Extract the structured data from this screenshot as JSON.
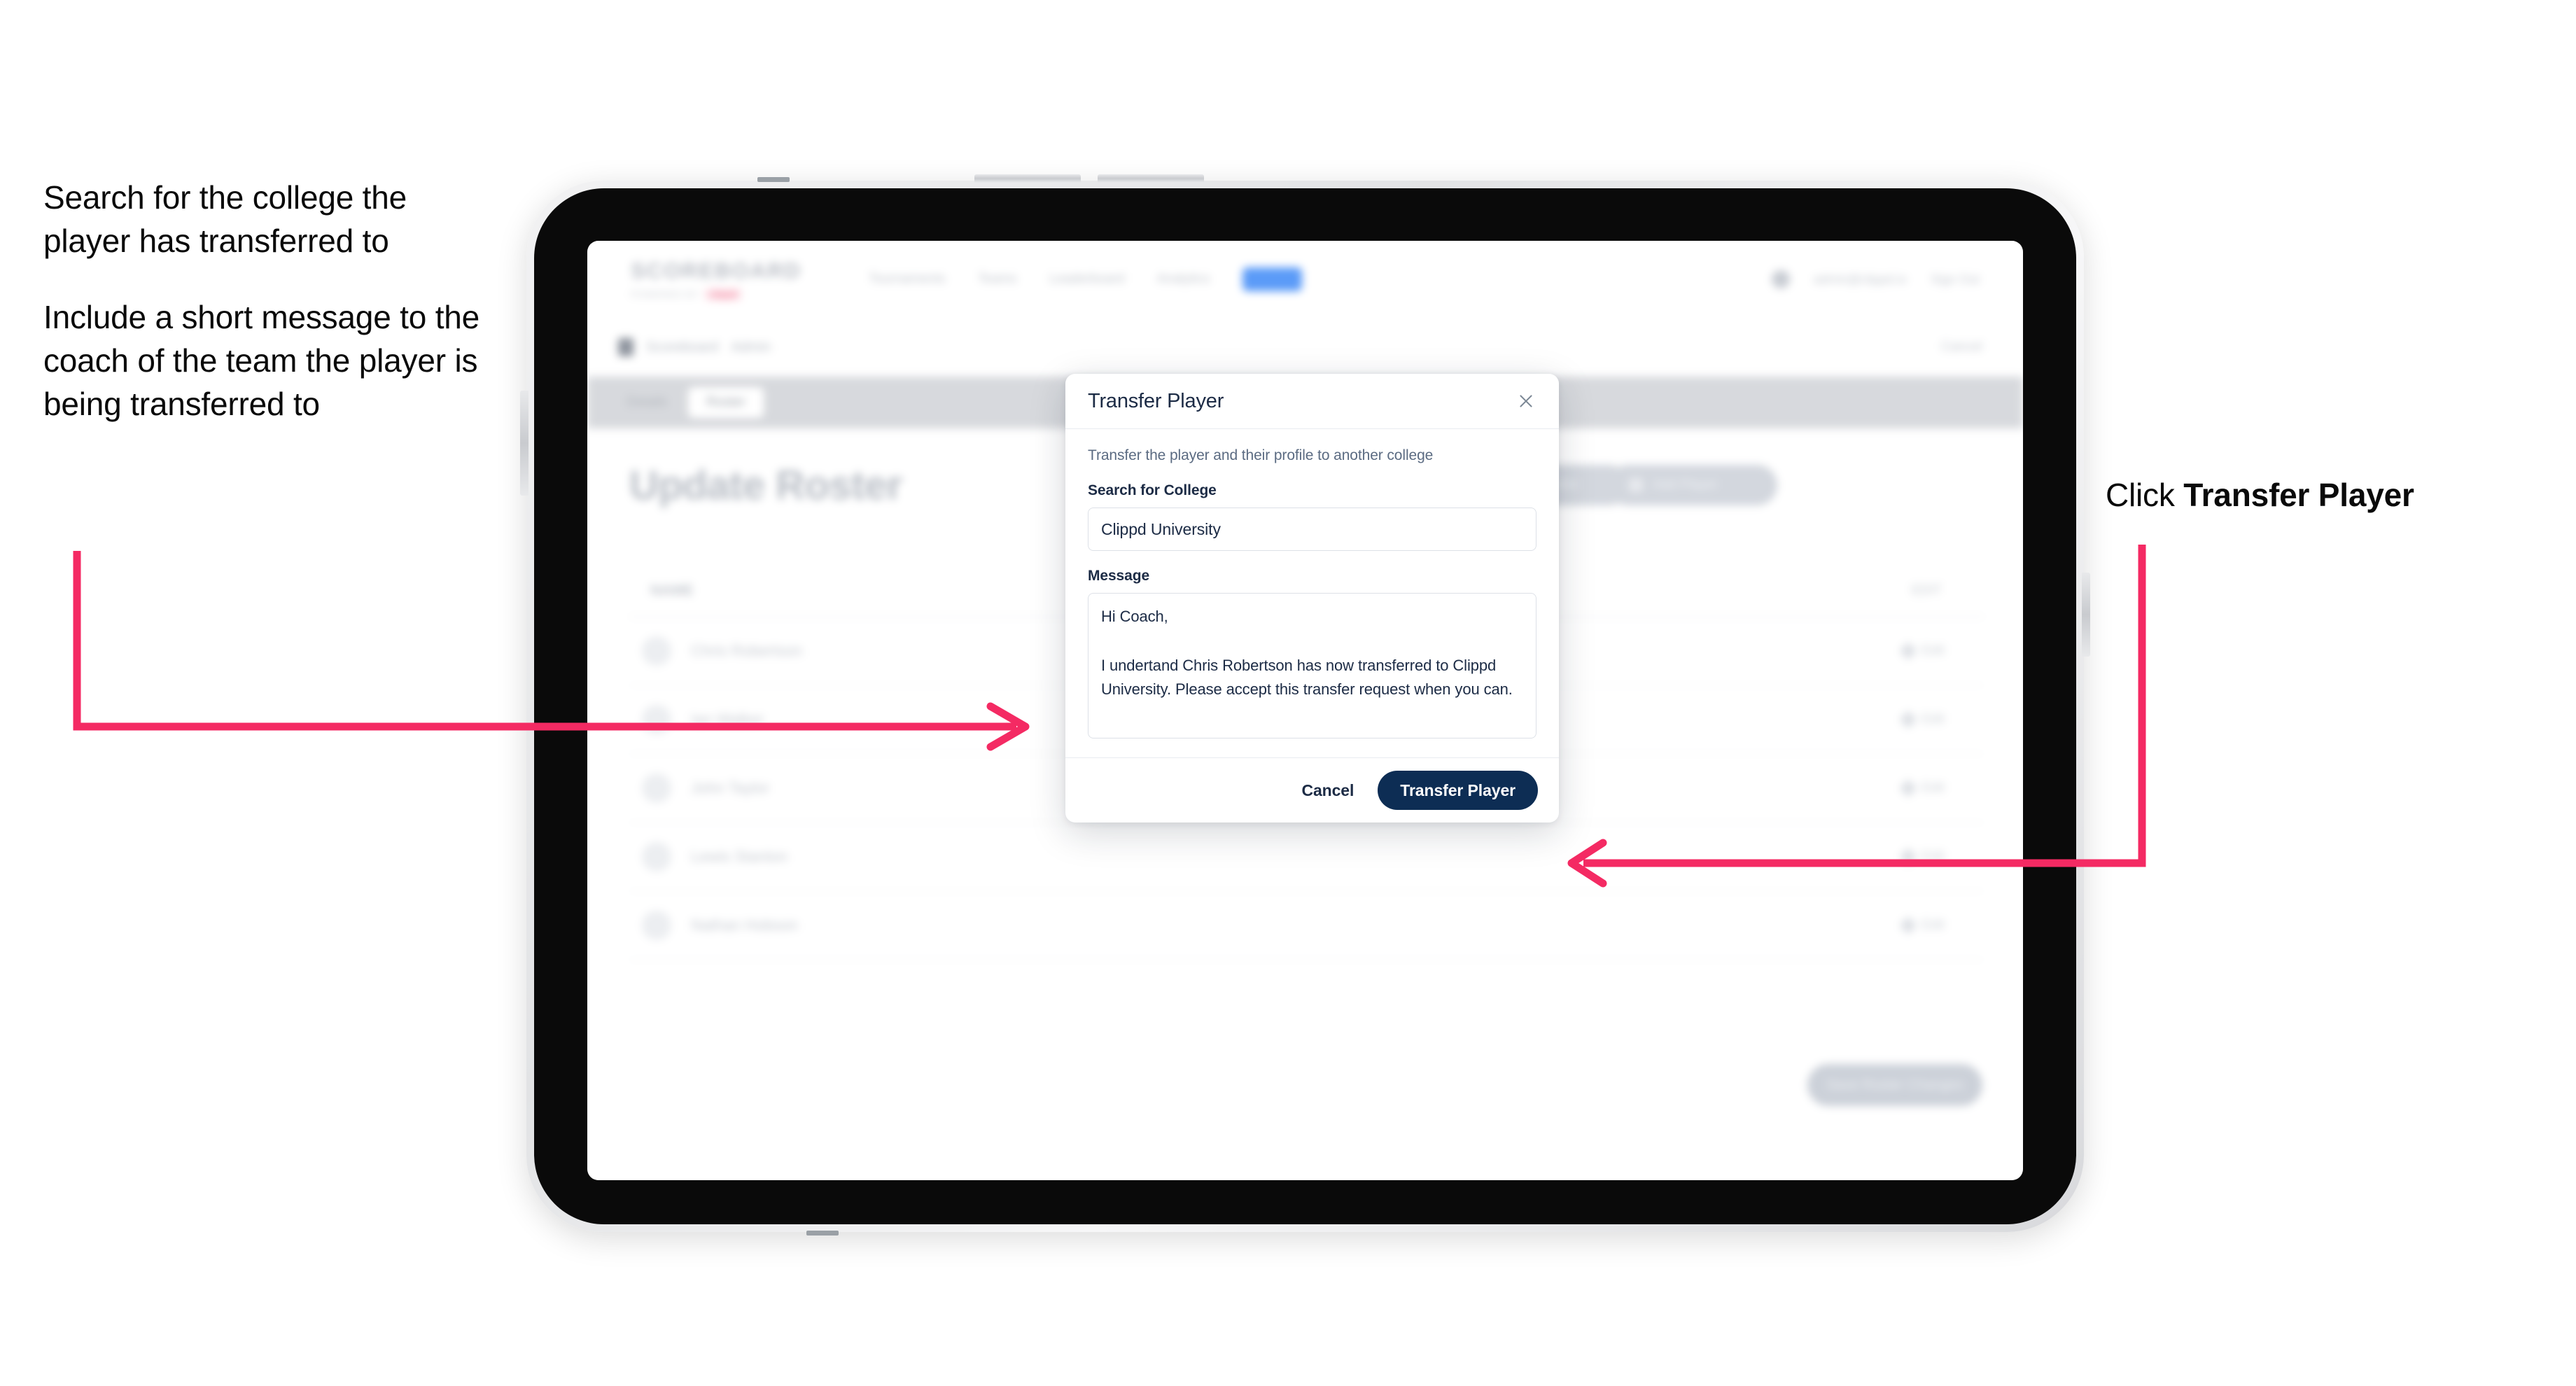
{
  "annotations": {
    "left": [
      "Search for the college the player has transferred to",
      "Include a short message to the coach of the team the player is being transferred to"
    ],
    "right_prefix": "Click ",
    "right_bold": "Transfer Player",
    "arrow_color": "#f42a63"
  },
  "app": {
    "logo": {
      "main": "SCOREBOARD",
      "sub": "POWERED BY",
      "badge": "clippd"
    },
    "nav_links": [
      {
        "label": "Tournaments",
        "active": true
      },
      {
        "label": "Teams",
        "active": false
      },
      {
        "label": "Leaderboard",
        "active": false
      },
      {
        "label": "Analytics",
        "active": false
      },
      {
        "label": "Admin",
        "active": false,
        "pill": true
      }
    ],
    "nav_right": {
      "email": "admin@clippd.io",
      "sign_out": "Sign Out"
    },
    "breadcrumb": {
      "text": "Scoreboard",
      "sub": "Admin",
      "right": "Cancel"
    },
    "tabs": [
      {
        "label": "Details",
        "active": false
      },
      {
        "label": "Roster",
        "active": true
      }
    ],
    "page_title": "Update Roster",
    "header_buttons": [
      "Request Player Transfer",
      "Add Player"
    ],
    "table": {
      "col_name": "NAME",
      "col_action": "EDIT",
      "rows": [
        {
          "name": "Chris Robertson",
          "action": "Edit"
        },
        {
          "name": "Ian Walker",
          "action": "Edit"
        },
        {
          "name": "John Taylor",
          "action": "Edit"
        },
        {
          "name": "Lewis Stanton",
          "action": "Edit"
        },
        {
          "name": "Nathan Hobson",
          "action": "Edit"
        }
      ]
    },
    "save_button": "Save Roster Changes"
  },
  "modal": {
    "title": "Transfer Player",
    "close_icon": "close-icon",
    "description": "Transfer the player and their profile to another college",
    "college_field": {
      "label": "Search for College",
      "value": "Clippd University",
      "placeholder": "Search for College"
    },
    "message_field": {
      "label": "Message",
      "value": "Hi Coach,\n\nI undertand Chris Robertson has now transferred to Clippd University. Please accept this transfer request when you can.",
      "placeholder": "Message"
    },
    "cancel_label": "Cancel",
    "submit_label": "Transfer Player",
    "submit_color": "#0d2d54"
  }
}
